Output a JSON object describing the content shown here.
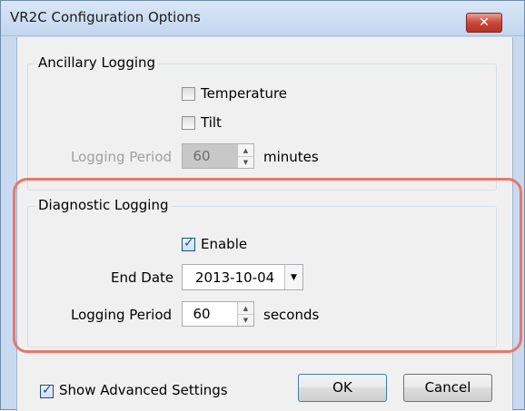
{
  "window": {
    "title": "VR2C Configuration Options",
    "close_glyph": "✕"
  },
  "ancillary": {
    "legend": "Ancillary Logging",
    "temperature": {
      "label": "Temperature",
      "checked": false
    },
    "tilt": {
      "label": "Tilt",
      "checked": false
    },
    "period": {
      "label": "Logging Period",
      "value": "60",
      "unit": "minutes",
      "enabled": false
    }
  },
  "diagnostic": {
    "legend": "Diagnostic Logging",
    "enable": {
      "label": "Enable",
      "checked": true
    },
    "end_date": {
      "label": "End Date",
      "value": "2013-10-04"
    },
    "period": {
      "label": "Logging Period",
      "value": "60",
      "unit": "seconds",
      "enabled": true
    }
  },
  "footer": {
    "advanced": {
      "label": "Show Advanced Settings",
      "checked": true
    },
    "ok_label": "OK",
    "cancel_label": "Cancel"
  },
  "icons": {
    "up": "▲",
    "down": "▼"
  },
  "colors": {
    "highlight": "#e8766d"
  }
}
